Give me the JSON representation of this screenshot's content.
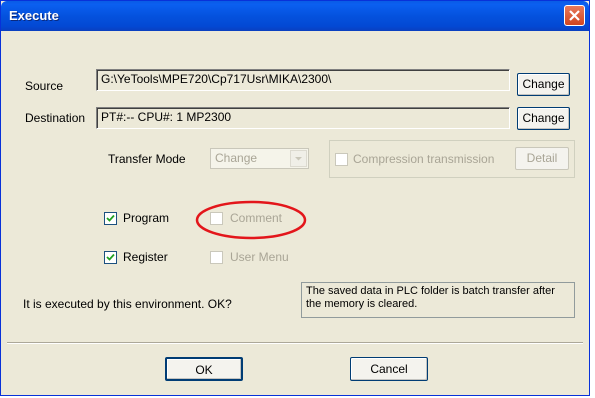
{
  "window": {
    "title": "Execute",
    "close_icon": "close-icon"
  },
  "source": {
    "label": "Source",
    "value": "G:\\YeTools\\MPE720\\Cp717Usr\\MIKA\\2300\\",
    "button": "Change"
  },
  "destination": {
    "label": "Destination",
    "value": "PT#:-- CPU#: 1    MP2300",
    "button": "Change"
  },
  "transfer_mode": {
    "label": "Transfer Mode",
    "selected": "Change"
  },
  "compression": {
    "label": "Compression transmission",
    "checked": false,
    "detail_button": "Detail"
  },
  "options": {
    "program": {
      "label": "Program",
      "checked": true
    },
    "comment": {
      "label": "Comment",
      "checked": false,
      "enabled": false
    },
    "register": {
      "label": "Register",
      "checked": true
    },
    "user_menu": {
      "label": "User Menu",
      "checked": false,
      "enabled": false
    }
  },
  "confirm_text": "It is executed by this environment. OK?",
  "note_text": "The saved data in PLC folder is batch transfer after the memory is cleared.",
  "buttons": {
    "ok": "OK",
    "cancel": "Cancel"
  },
  "colors": {
    "title_bar": "#0452de",
    "dialog_bg": "#ece9d8",
    "highlight_circle": "#e3161b"
  }
}
